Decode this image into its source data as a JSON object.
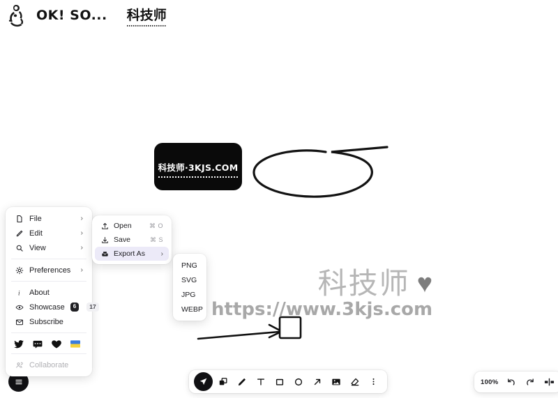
{
  "header": {
    "logo_alt": "sitting-figure-logo",
    "title": "OK! SO...",
    "brand_cjk": "科技师"
  },
  "canvas": {
    "black_card_text": "科技师·3KJS.COM",
    "doodle_name": "hand-drawn-loop",
    "arrow_name": "hand-drawn-arrow",
    "square_name": "hand-drawn-square"
  },
  "watermark": {
    "brand": "科技师",
    "heart": "♥",
    "url": "https://www.3kjs.com"
  },
  "menu": {
    "groups": [
      {
        "items": [
          {
            "label": "File",
            "icon": "file-icon",
            "chevron": "›"
          },
          {
            "label": "Edit",
            "icon": "pencil-icon",
            "chevron": "›"
          },
          {
            "label": "View",
            "icon": "search-icon",
            "chevron": "›"
          }
        ]
      },
      {
        "items": [
          {
            "label": "Preferences",
            "icon": "gear-icon",
            "chevron": "›"
          }
        ]
      },
      {
        "items": [
          {
            "label": "About",
            "icon": "info-icon",
            "chevron": ""
          },
          {
            "label": "Showcase",
            "icon": "eye-icon",
            "badge_dark": "6",
            "badge_light": "17",
            "chevron": ""
          },
          {
            "label": "Subscribe",
            "icon": "envelope-icon",
            "chevron": ""
          }
        ]
      }
    ],
    "social": [
      {
        "name": "twitter-icon"
      },
      {
        "name": "chat-icon"
      },
      {
        "name": "heart-icon"
      },
      {
        "name": "ukraine-flag-icon"
      }
    ],
    "collaborate": {
      "label": "Collaborate",
      "icon": "people-icon"
    }
  },
  "file_submenu": {
    "items": [
      {
        "label": "Open",
        "icon": "upload-icon",
        "shortcut": "⌘ O",
        "chevron": ""
      },
      {
        "label": "Save",
        "icon": "download-icon",
        "shortcut": "⌘ S",
        "chevron": ""
      },
      {
        "label": "Export As",
        "icon": "export-icon",
        "shortcut": "",
        "chevron": "›",
        "active": true
      }
    ]
  },
  "export_formats": [
    "PNG",
    "SVG",
    "JPG",
    "WEBP"
  ],
  "toolbar": {
    "tools": [
      {
        "name": "select-tool",
        "selected": true
      },
      {
        "name": "shapes-tool",
        "selected": false
      },
      {
        "name": "pen-tool",
        "selected": false
      },
      {
        "name": "text-tool",
        "selected": false
      },
      {
        "name": "rectangle-tool",
        "selected": false
      },
      {
        "name": "ellipse-tool",
        "selected": false
      },
      {
        "name": "arrow-tool",
        "selected": false
      },
      {
        "name": "image-tool",
        "selected": false
      },
      {
        "name": "eraser-tool",
        "selected": false
      },
      {
        "name": "more-options-tool",
        "selected": false
      }
    ]
  },
  "zoombar": {
    "level": "100%",
    "undo": "undo-icon",
    "redo": "redo-icon",
    "laser": "laser-pointer-icon"
  },
  "colors": {
    "accent_dark": "#111114",
    "panel_bg": "#ffffff",
    "highlight": "#eceaf8",
    "watermark_gray": "#b6b6b6"
  }
}
